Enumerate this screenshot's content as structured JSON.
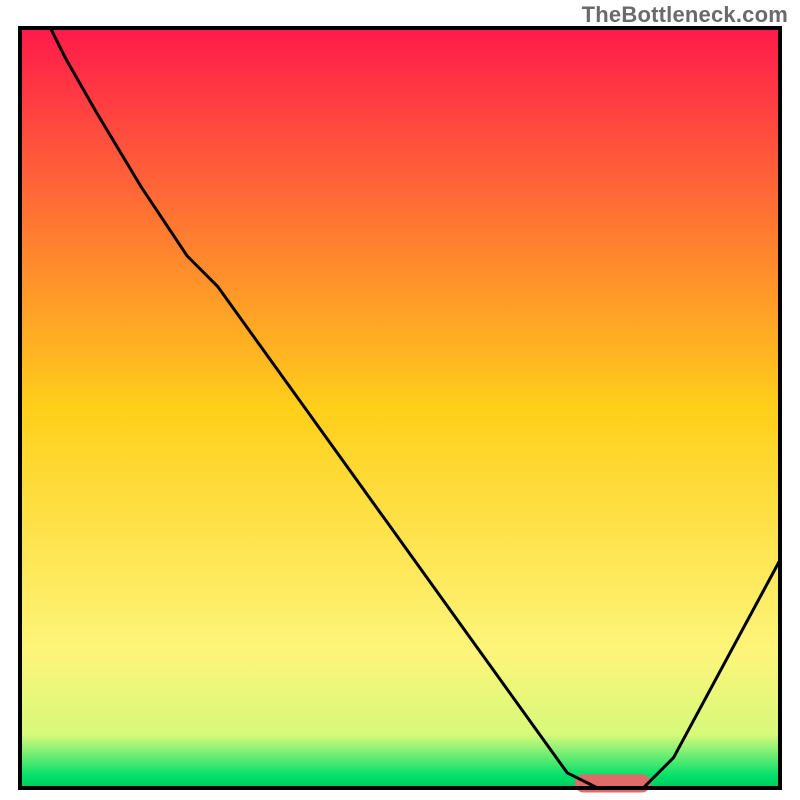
{
  "watermark": "TheBottleneck.com",
  "chart_data": {
    "type": "line",
    "title": "",
    "xlabel": "",
    "ylabel": "",
    "xlim": [
      0,
      100
    ],
    "ylim": [
      0,
      100
    ],
    "grid": false,
    "legend": false,
    "background_gradient": {
      "stops": [
        {
          "offset": 0.0,
          "color": "#ff1a4b"
        },
        {
          "offset": 0.5,
          "color": "#ffcf1a"
        },
        {
          "offset": 0.82,
          "color": "#fdf57a"
        },
        {
          "offset": 0.93,
          "color": "#d7f97a"
        },
        {
          "offset": 0.985,
          "color": "#00e06a"
        },
        {
          "offset": 1.0,
          "color": "#00c85f"
        }
      ]
    },
    "series": [
      {
        "name": "bottleneck-curve",
        "color": "#000000",
        "x": [
          4,
          6,
          10,
          16,
          22,
          26,
          72,
          76,
          82,
          86,
          100
        ],
        "y": [
          100,
          96,
          89,
          79,
          70,
          66,
          2,
          0,
          0,
          4,
          30
        ]
      }
    ],
    "marker": {
      "name": "optimal-range",
      "x_start": 73,
      "x_end": 83,
      "y": 0.6,
      "color": "#e06a6a",
      "thickness": 2.4
    },
    "frame_color": "#000000",
    "frame_width": 4
  }
}
